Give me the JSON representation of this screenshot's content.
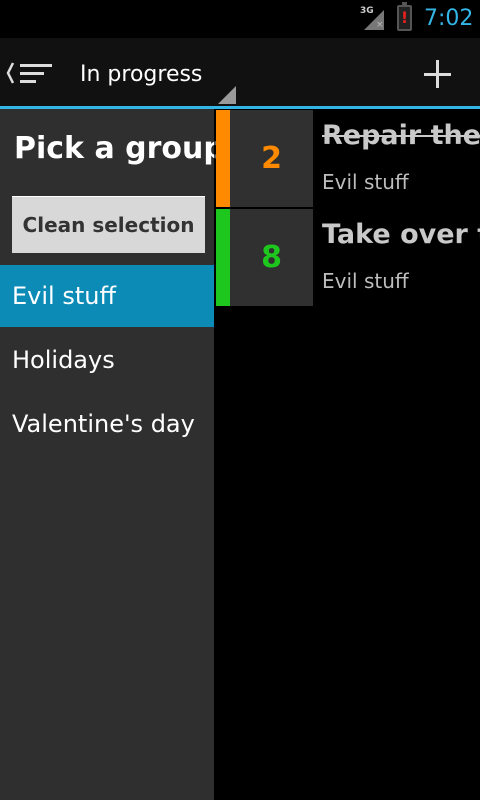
{
  "status_bar": {
    "network_label": "3G",
    "time": "7:02",
    "battery_alert": "!"
  },
  "action_bar": {
    "filter_selected": "In progress",
    "add_icon": "plus-icon",
    "drawer_icon": "drawer-toggle-icon"
  },
  "drawer": {
    "title": "Pick a group",
    "clean_button": "Clean selection",
    "groups": [
      {
        "label": "Evil stuff",
        "selected": true
      },
      {
        "label": "Holidays",
        "selected": false
      },
      {
        "label": "Valentine's day",
        "selected": false
      }
    ]
  },
  "tasks": [
    {
      "count": "2",
      "title": "Repair the \"",
      "group": "Evil stuff",
      "done": true,
      "color": "#ff8a00"
    },
    {
      "count": "8",
      "title": "Take over th",
      "group": "Evil stuff",
      "done": false,
      "color": "#1ec71e"
    }
  ],
  "colors": {
    "accent": "#33b5e5",
    "selected_group": "#0c8bb7",
    "task1": "#ff8a00",
    "task2": "#1ec71e"
  }
}
